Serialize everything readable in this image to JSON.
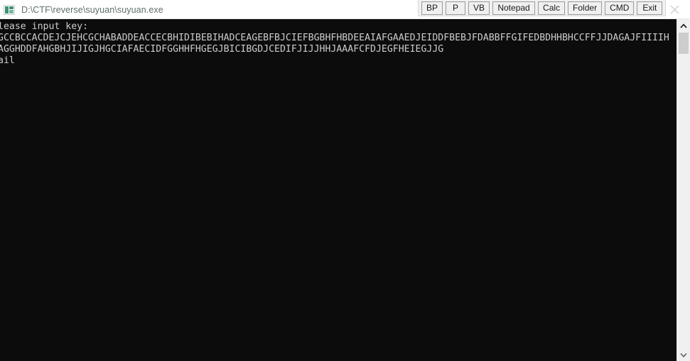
{
  "window": {
    "title": "D:\\CTF\\reverse\\suyuan\\suyuan.exe",
    "icon": "console-app-icon"
  },
  "toolbar": {
    "buttons": [
      {
        "label": "BP",
        "name": "toolbar-button-bp"
      },
      {
        "label": "P",
        "name": "toolbar-button-p"
      },
      {
        "label": "VB",
        "name": "toolbar-button-vb"
      },
      {
        "label": "Notepad",
        "name": "toolbar-button-notepad"
      },
      {
        "label": "Calc",
        "name": "toolbar-button-calc"
      },
      {
        "label": "Folder",
        "name": "toolbar-button-folder"
      },
      {
        "label": "CMD",
        "name": "toolbar-button-cmd"
      },
      {
        "label": "Exit",
        "name": "toolbar-button-exit"
      }
    ],
    "close_label": "close-icon"
  },
  "console": {
    "background_color": "#0c0c0c",
    "text_color": "#cccccc",
    "lines": [
      "lease input key:",
      "GCCBCCACDEJCJEHCGCHABADDEACCECBHIDIBEBIHADCEAGEBFBJCIEFBGBHFHBDEEAIAFGAAEDJEIDDFBEBJFDABBFFGIFEDBDHHBHCCFFJJDAGAJFIIIIH",
      "AGGHDDFAHGBHJIJIGJHGCIAFAECIDFGGHHFHGEGJBICIBGDJCEDIFJIJJHHJAAAFCFDJEGFHEIEGJJG",
      "ail"
    ],
    "full_text": "lease input key:\nGCCBCCACDEJCJEHCGCHABADDEACCECBHIDIBEBIHADCEAGEBFBJCIEFBGBHFHBDEEAIAFGAAEDJEIDDFBEBJFDABBFFGIFEDBDHHBHCCFFJJDAGAJFIIIIH\nAGGHDDFAHGBHJIJIGJHGCIAFAECIDFGGHHFHGEGJBICIBGDJCEDIFJIJJHHJAAAFCFDJEGFHEIEGJJG\nail"
  },
  "scrollbar": {
    "up_arrow": "chevron-up-icon",
    "down_arrow": "chevron-down-icon",
    "thumb": "scrollbar-thumb"
  }
}
